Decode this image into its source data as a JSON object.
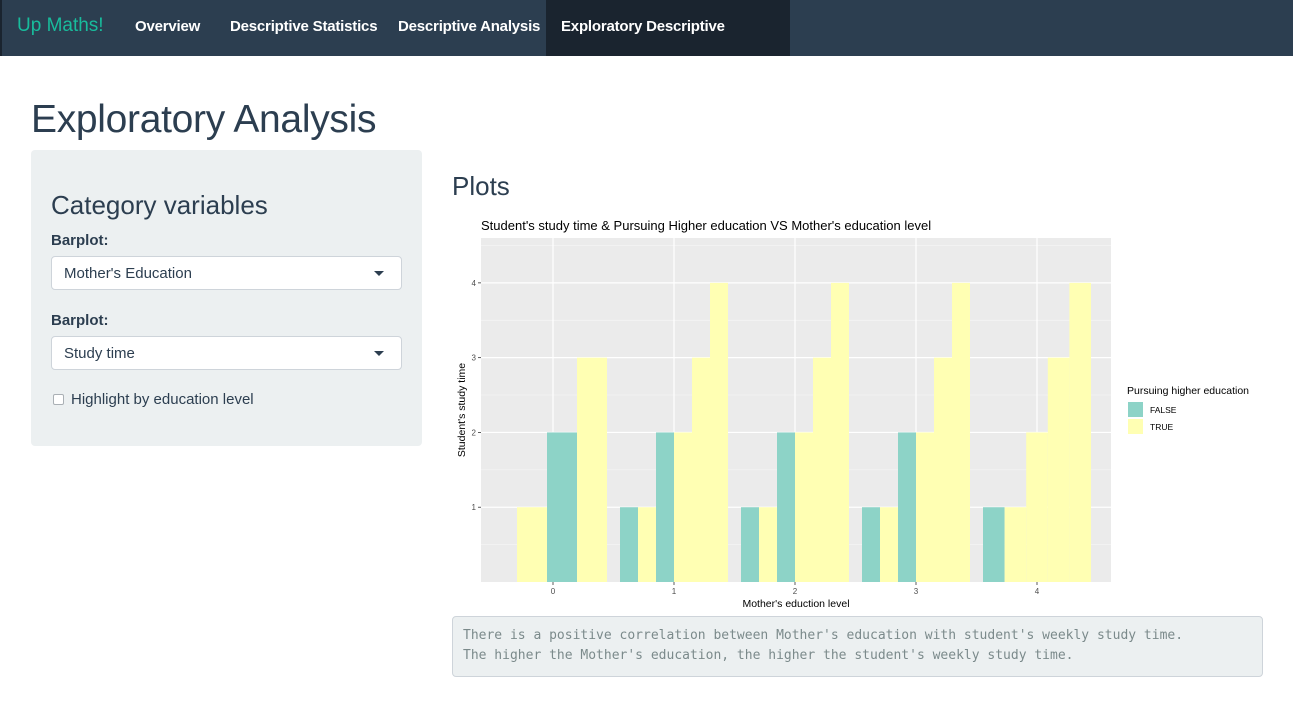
{
  "navbar": {
    "brand": "Up Maths!",
    "tabs": [
      {
        "label": "Overview",
        "active": false
      },
      {
        "label": "Descriptive Statistics",
        "active": false
      },
      {
        "label": "Descriptive Analysis",
        "active": false
      },
      {
        "label": "Exploratory Descriptive Analysis",
        "active": true
      }
    ]
  },
  "page_title": "Exploratory Analysis",
  "sidebar": {
    "title": "Category variables",
    "controls": [
      {
        "label": "Barplot:",
        "selected": "Mother's Education"
      },
      {
        "label": "Barplot:",
        "selected": "Study time"
      }
    ],
    "checkbox": {
      "label": "Highlight by education level",
      "checked": false
    }
  },
  "main": {
    "plots_title": "Plots",
    "output_text": "There is a positive correlation between Mother's education with student's weekly study time.\nThe higher the Mother's education, the higher the student's weekly study time."
  },
  "colors": {
    "navbar": "#2c3e50",
    "brand": "#18bc9c",
    "panel": "#ecf0f1",
    "false_fill": "#8dd3c7",
    "true_fill": "#ffffb3",
    "plot_bg": "#ebebeb"
  },
  "chart_data": {
    "type": "bar",
    "title": "Student's study time & Pursuing Higher education VS Mother's education level",
    "xlabel": "Mother's eduction level",
    "ylabel": "Student's study time",
    "categories": [
      "0",
      "1",
      "2",
      "3",
      "4"
    ],
    "y_ticks": [
      "1",
      "2",
      "3",
      "4"
    ],
    "ylim": [
      0,
      4.6
    ],
    "grid": true,
    "legend": {
      "title": "Pursuing higher education",
      "position": "right",
      "entries": [
        "FALSE",
        "TRUE"
      ]
    },
    "bars": [
      {
        "category": "0",
        "group": "TRUE",
        "value": 1
      },
      {
        "category": "0",
        "group": "FALSE",
        "value": 2
      },
      {
        "category": "0",
        "group": "TRUE",
        "value": 3
      },
      {
        "category": "1",
        "group": "FALSE",
        "value": 1
      },
      {
        "category": "1",
        "group": "TRUE",
        "value": 1
      },
      {
        "category": "1",
        "group": "FALSE",
        "value": 2
      },
      {
        "category": "1",
        "group": "TRUE",
        "value": 2
      },
      {
        "category": "1",
        "group": "TRUE",
        "value": 3
      },
      {
        "category": "1",
        "group": "TRUE",
        "value": 4
      },
      {
        "category": "2",
        "group": "FALSE",
        "value": 1
      },
      {
        "category": "2",
        "group": "TRUE",
        "value": 1
      },
      {
        "category": "2",
        "group": "FALSE",
        "value": 2
      },
      {
        "category": "2",
        "group": "TRUE",
        "value": 2
      },
      {
        "category": "2",
        "group": "TRUE",
        "value": 3
      },
      {
        "category": "2",
        "group": "TRUE",
        "value": 4
      },
      {
        "category": "3",
        "group": "FALSE",
        "value": 1
      },
      {
        "category": "3",
        "group": "TRUE",
        "value": 1
      },
      {
        "category": "3",
        "group": "FALSE",
        "value": 2
      },
      {
        "category": "3",
        "group": "TRUE",
        "value": 2
      },
      {
        "category": "3",
        "group": "TRUE",
        "value": 3
      },
      {
        "category": "3",
        "group": "TRUE",
        "value": 4
      },
      {
        "category": "4",
        "group": "FALSE",
        "value": 1
      },
      {
        "category": "4",
        "group": "TRUE",
        "value": 1
      },
      {
        "category": "4",
        "group": "TRUE",
        "value": 2
      },
      {
        "category": "4",
        "group": "TRUE",
        "value": 3
      },
      {
        "category": "4",
        "group": "TRUE",
        "value": 4
      }
    ]
  }
}
